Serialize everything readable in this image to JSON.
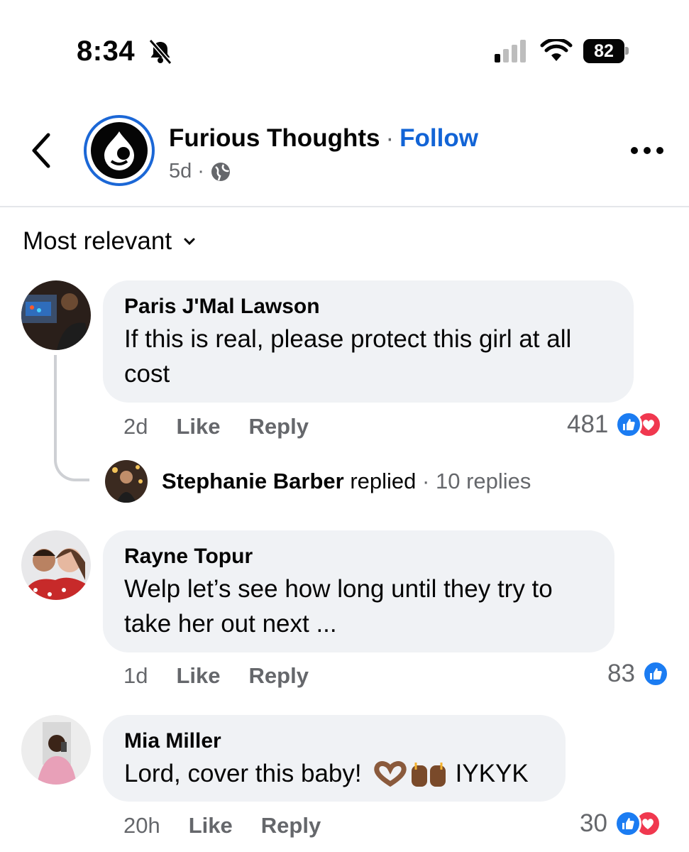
{
  "status_bar": {
    "time": "8:34",
    "battery": "82"
  },
  "header": {
    "page_name": "Furious Thoughts",
    "separator": "·",
    "follow": "Follow",
    "age": "5d",
    "meta_separator": "·"
  },
  "sort": {
    "label": "Most relevant"
  },
  "comments": [
    {
      "author": "Paris J'Mal Lawson",
      "text": "If this is real, please protect this girl at all cost",
      "time": "2d",
      "like": "Like",
      "reply": "Reply",
      "reaction_count": "481",
      "reactions": [
        "like-icon",
        "love-icon"
      ],
      "reply_summary": {
        "author": "Stephanie Barber",
        "action": "replied",
        "separator": "·",
        "count": "10 replies"
      }
    },
    {
      "author": "Rayne Topur",
      "text": "Welp let’s see how long until they try to take her out next ...",
      "time": "1d",
      "like": "Like",
      "reply": "Reply",
      "reaction_count": "83",
      "reactions": [
        "like-icon"
      ]
    },
    {
      "author": "Mia Miller",
      "text": "Lord, cover this baby!",
      "text_suffix": "IYKYK",
      "time": "20h",
      "like": "Like",
      "reply": "Reply",
      "reaction_count": "30",
      "reactions": [
        "like-icon",
        "love-icon"
      ]
    }
  ],
  "colors": {
    "follow_blue": "#1264d6",
    "bubble_bg": "#f0f2f5",
    "like_blue": "#1b7cf2",
    "love_red": "#f0384f",
    "muted_text": "#65676b"
  }
}
